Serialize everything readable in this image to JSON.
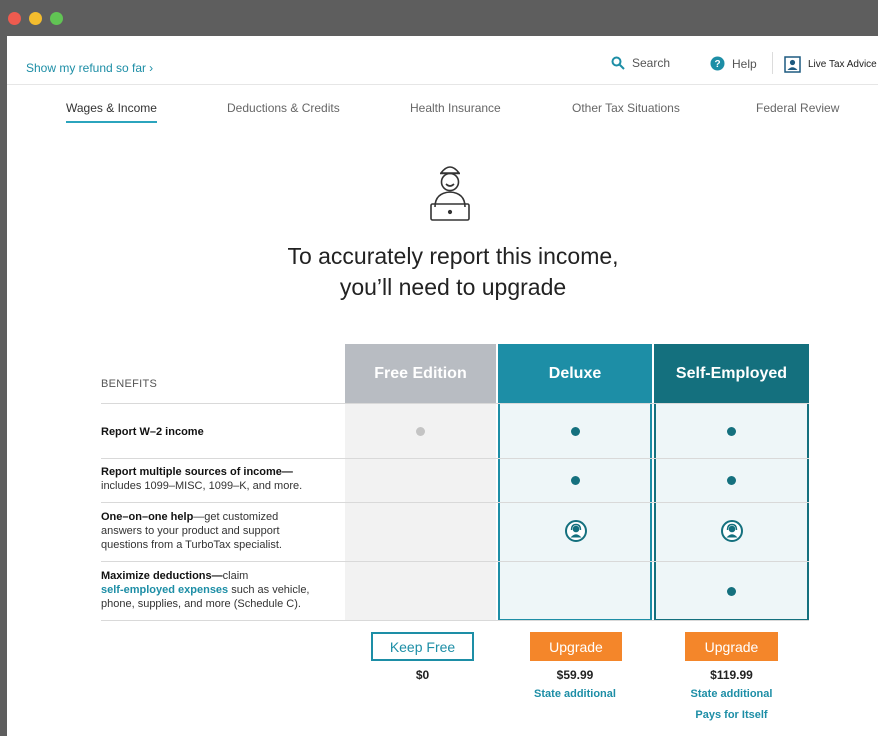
{
  "topbar": {
    "refund_link": "Show my refund so far",
    "search_label": "Search",
    "help_label": "Help",
    "advice_label": "Live Tax Advice"
  },
  "nav": {
    "items": [
      {
        "label": "Wages & Income",
        "active": true
      },
      {
        "label": "Deductions & Credits",
        "active": false
      },
      {
        "label": "Health Insurance",
        "active": false
      },
      {
        "label": "Other Tax Situations",
        "active": false
      },
      {
        "label": "Federal Review",
        "active": false
      }
    ]
  },
  "headline": {
    "line1": "To accurately report this income,",
    "line2": "you’ll need to upgrade"
  },
  "table": {
    "benefits_heading": "BENEFITS",
    "columns": [
      {
        "name": "Free Edition",
        "color": "#b8bcc2"
      },
      {
        "name": "Deluxe",
        "color": "#1d8ea6"
      },
      {
        "name": "Self-Employed",
        "color": "#14707e"
      }
    ],
    "rows": [
      {
        "title": "Report W–2 income",
        "detail": "",
        "free": "dot",
        "deluxe": "dot",
        "self_employed": "dot"
      },
      {
        "title": "Report multiple sources of income—",
        "detail": "includes 1099–MISC, 1099–K, and more.",
        "free": "none",
        "deluxe": "dot",
        "self_employed": "dot"
      },
      {
        "title": "One–on–one help",
        "detail": "—get customized answers to your product and support questions from a TurboTax specialist.",
        "free": "none",
        "deluxe": "specialist",
        "self_employed": "specialist"
      },
      {
        "title": "Maximize deductions—",
        "detail_pre": "claim",
        "detail_link": "self-employed expenses",
        "detail_post": " such as vehicle, phone, supplies, and more (Schedule C).",
        "free": "none",
        "deluxe": "none",
        "self_employed": "dot"
      }
    ]
  },
  "plans": {
    "free": {
      "button": "Keep Free",
      "price": "$0"
    },
    "deluxe": {
      "button": "Upgrade",
      "price": "$59.99",
      "note": "State additional"
    },
    "self_employed": {
      "button": "Upgrade",
      "price": "$119.99",
      "note": "State additional",
      "note2": "Pays for Itself"
    }
  },
  "colors": {
    "teal": "#1d8ea6",
    "dark_teal": "#14707e",
    "orange": "#f4862a",
    "free_grey": "#b8bcc2"
  }
}
